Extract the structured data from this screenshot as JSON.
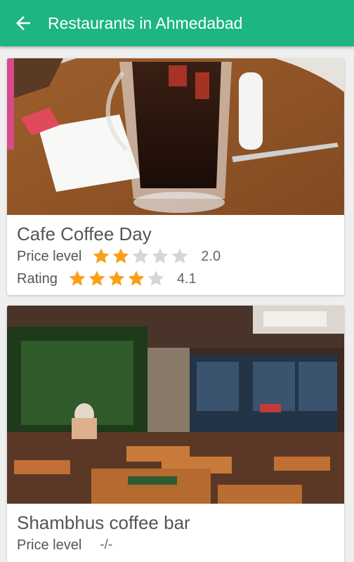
{
  "header": {
    "title": "Restaurants in Ahmedabad",
    "back_icon": "arrow-back-icon"
  },
  "colors": {
    "primary": "#1db581",
    "star_filled": "#f9a01b",
    "star_empty": "#d6d6d6"
  },
  "restaurants": [
    {
      "name": "Cafe Coffee Day",
      "price_label": "Price level",
      "price_value": "2.0",
      "price_stars": 2,
      "rating_label": "Rating",
      "rating_value": "4.1",
      "rating_stars": 4,
      "photo": "coffee-glass-photo"
    },
    {
      "name": "Shambhus coffee bar",
      "price_label": "Price level",
      "price_value": "-/-",
      "photo": "restaurant-interior-photo"
    }
  ]
}
